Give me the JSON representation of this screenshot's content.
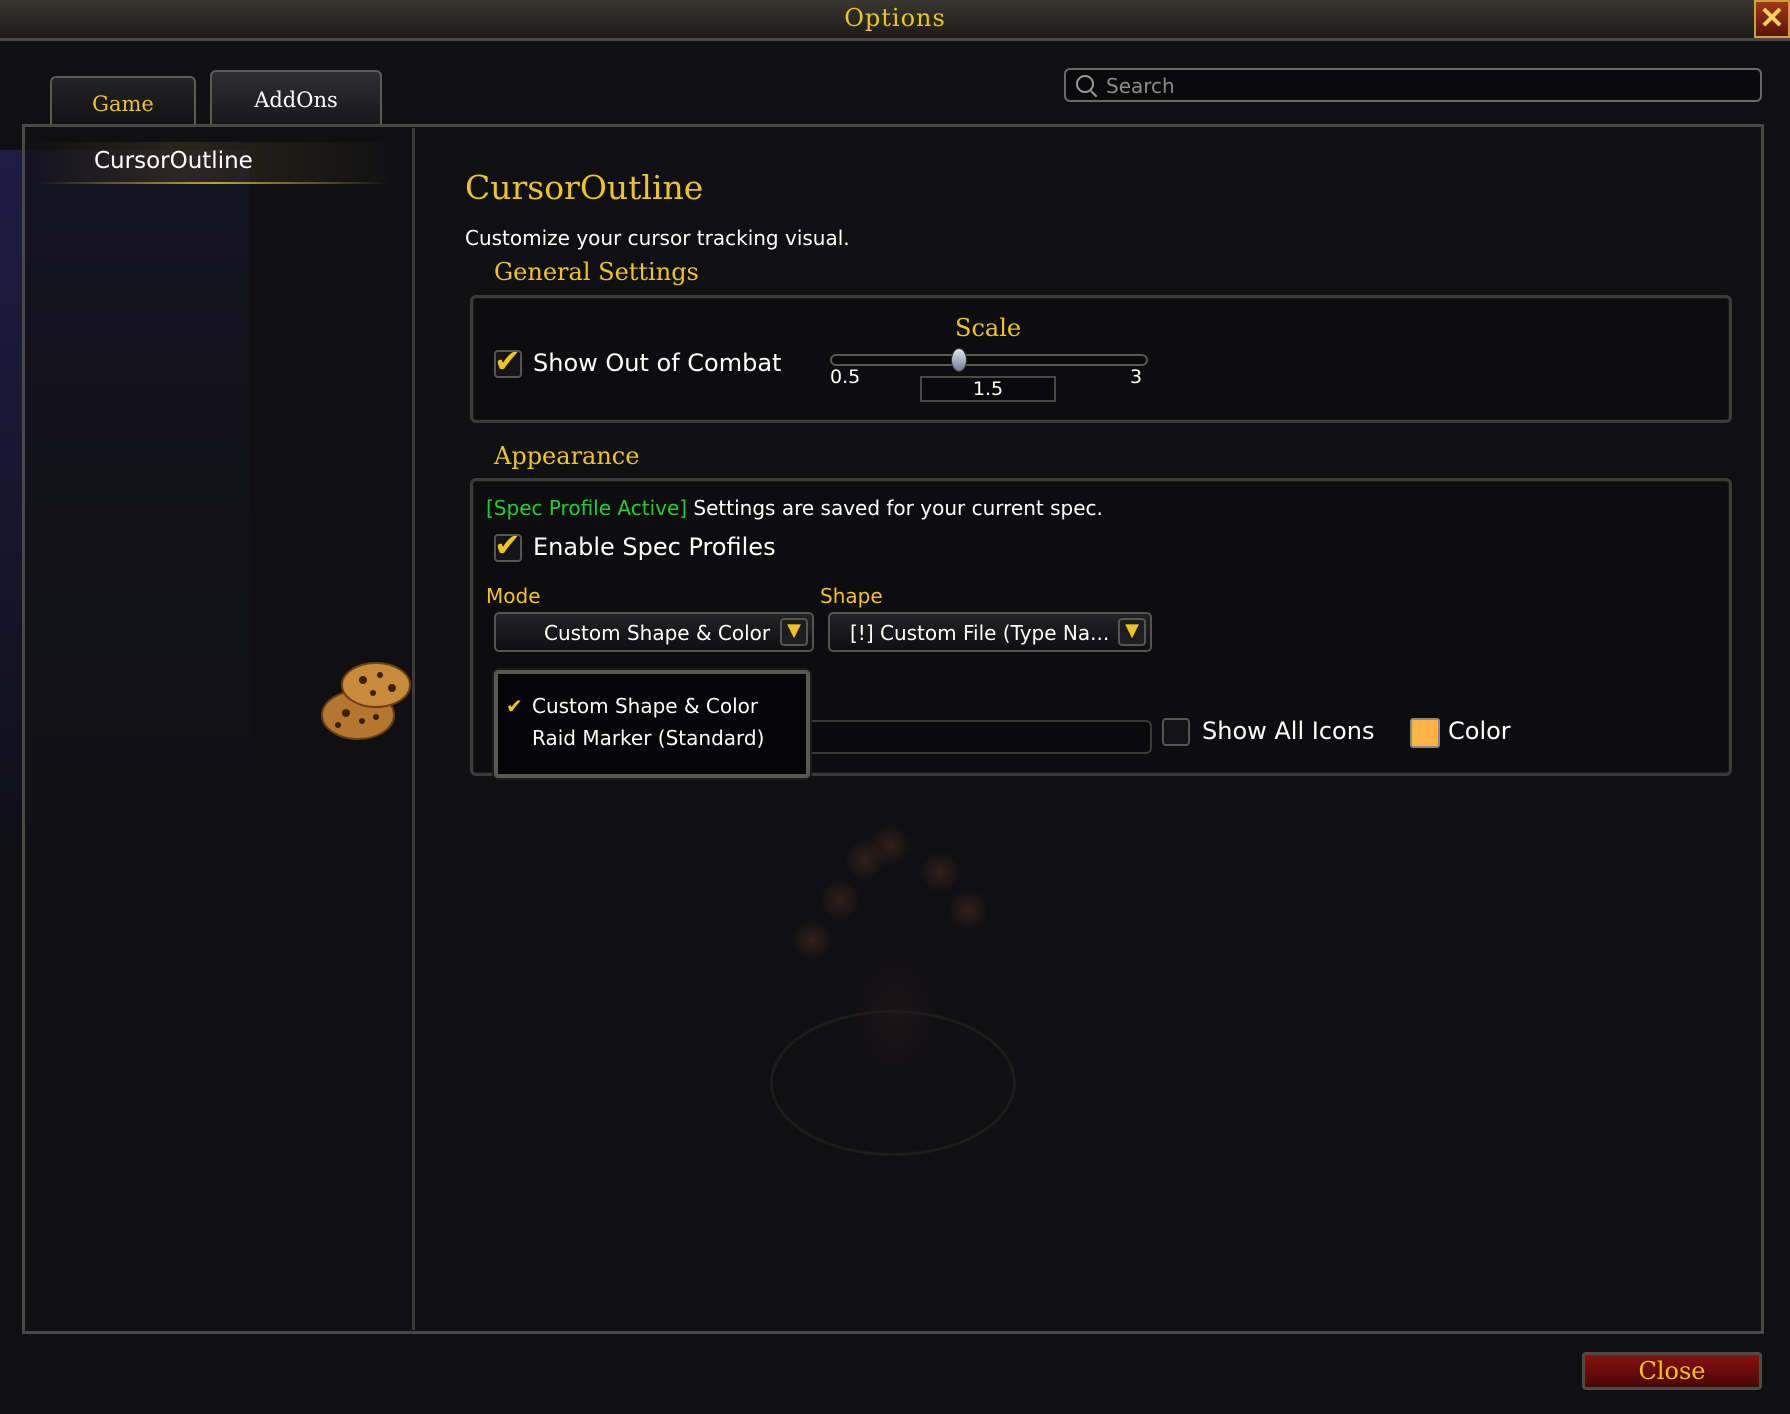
{
  "window": {
    "title": "Options",
    "close_icon": "close-x-icon"
  },
  "tabs": [
    {
      "label": "Game",
      "active": false
    },
    {
      "label": "AddOns",
      "active": true
    }
  ],
  "search": {
    "placeholder": "Search",
    "value": ""
  },
  "sidebar": {
    "items": [
      {
        "label": "CursorOutline",
        "selected": true
      }
    ]
  },
  "main": {
    "title": "CursorOutline",
    "description": "Customize your cursor tracking visual.",
    "general": {
      "title": "General Settings",
      "show_out_of_combat": {
        "label": "Show Out of Combat",
        "checked": true
      },
      "scale": {
        "label": "Scale",
        "min": "0.5",
        "max": "3",
        "value": "1.5",
        "position": 0.4
      }
    },
    "appearance": {
      "title": "Appearance",
      "spec_tag": "[Spec Profile Active]",
      "spec_note": " Settings are saved for your current spec.",
      "enable_spec_profiles": {
        "label": "Enable Spec Profiles",
        "checked": true
      },
      "mode": {
        "label": "Mode",
        "value": "Custom Shape & Color"
      },
      "shape": {
        "label": "Shape",
        "value": "[!] Custom File (Type Na..."
      },
      "show_all_icons": {
        "label": "Show All Icons",
        "checked": false
      },
      "color": {
        "label": "Color",
        "swatch": "#ffb347"
      },
      "mode_menu": {
        "options": [
          {
            "label": "Custom Shape & Color",
            "checked": true
          },
          {
            "label": "Raid Marker (Standard)",
            "checked": false
          }
        ]
      }
    }
  },
  "footer": {
    "close_label": "Close"
  },
  "colors": {
    "gold": "#f0c420",
    "spec_green": "#22cc33",
    "close_red": "#8a1010"
  }
}
